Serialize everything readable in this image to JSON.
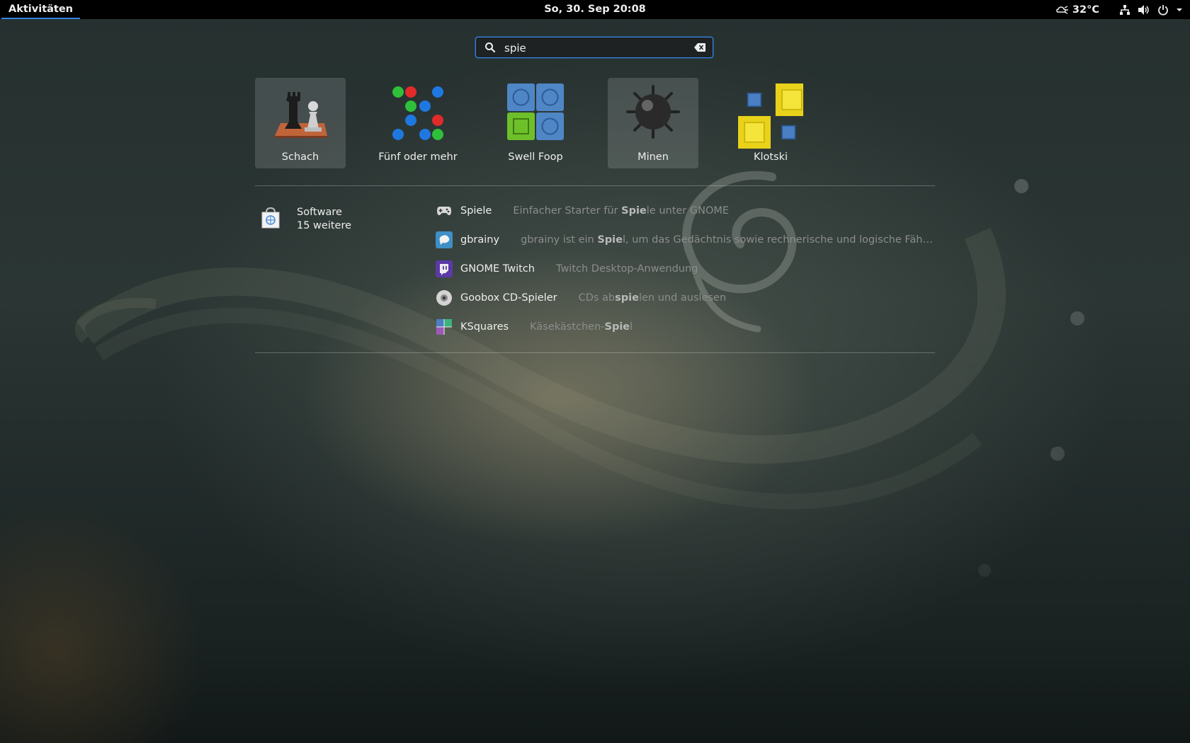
{
  "topbar": {
    "activities": "Aktivitäten",
    "clock": "So, 30. Sep  20:08",
    "temperature": "32°C",
    "icons": [
      "weather-icon",
      "network-icon",
      "volume-icon",
      "power-icon",
      "menu-arrow-icon"
    ]
  },
  "search": {
    "value": "spie",
    "icon": "search-icon",
    "clear_icon": "clear-icon"
  },
  "apps": [
    {
      "label": "Schach",
      "icon": "chess-icon",
      "selected": true
    },
    {
      "label": "Fünf oder mehr",
      "icon": "five-or-more-icon",
      "selected": false
    },
    {
      "label": "Swell Foop",
      "icon": "swell-foop-icon",
      "selected": false
    },
    {
      "label": "Minen",
      "icon": "mines-icon",
      "selected": true
    },
    {
      "label": "Klotski",
      "icon": "klotski-icon",
      "selected": false
    }
  ],
  "provider": {
    "name": "Software",
    "count": "15 weitere",
    "icon": "software-icon"
  },
  "results": [
    {
      "name": "Spiele",
      "desc_pre": "Einfacher Starter für ",
      "desc_match": "Spie",
      "desc_post": "le unter GNOME",
      "icon": "gamepad-icon"
    },
    {
      "name": "gbrainy",
      "desc_pre": "gbrainy ist ein ",
      "desc_match": "Spie",
      "desc_post": "l, um das Gedächtnis sowie rechnerische und logische Fähigkeiten mi…",
      "icon": "brain-icon"
    },
    {
      "name": "GNOME Twitch",
      "desc_pre": "Twitch Desktop-Anwendung",
      "desc_match": "",
      "desc_post": "",
      "icon": "twitch-icon"
    },
    {
      "name": "Goobox CD-Spieler",
      "desc_pre": "CDs ab",
      "desc_match": "spie",
      "desc_post": "len und auslesen",
      "icon": "cd-icon"
    },
    {
      "name": "KSquares",
      "desc_pre": "Käsekästchen-",
      "desc_match": "Spie",
      "desc_post": "l",
      "icon": "ksquares-icon"
    }
  ],
  "colors": {
    "accent": "#3584e4",
    "topbar": "#000000"
  }
}
